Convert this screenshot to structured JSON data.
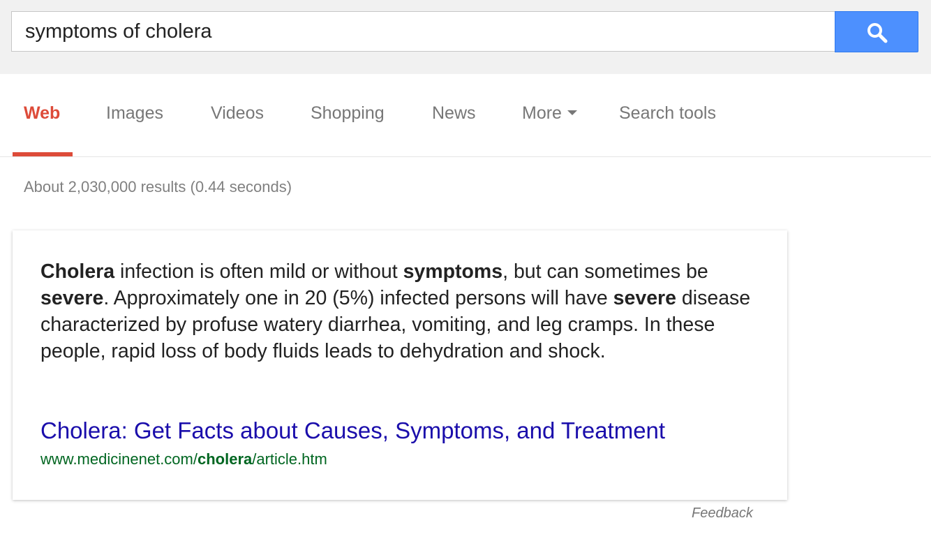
{
  "search": {
    "query": "symptoms of cholera",
    "button_icon": "search-icon"
  },
  "tabs": [
    {
      "label": "Web",
      "active": true
    },
    {
      "label": "Images",
      "active": false
    },
    {
      "label": "Videos",
      "active": false
    },
    {
      "label": "Shopping",
      "active": false
    },
    {
      "label": "News",
      "active": false
    },
    {
      "label": "More",
      "active": false,
      "icon": "caret-down-icon"
    },
    {
      "label": "Search tools",
      "active": false
    }
  ],
  "result_stats": "About 2,030,000 results (0.44 seconds)",
  "answer": {
    "segments": [
      {
        "text": "Cholera",
        "bold": true
      },
      {
        "text": " infection is often mild or without ",
        "bold": false
      },
      {
        "text": "symptoms",
        "bold": true
      },
      {
        "text": ", but can sometimes be ",
        "bold": false
      },
      {
        "text": "severe",
        "bold": true
      },
      {
        "text": ". Approximately one in 20 (5%) infected persons will have ",
        "bold": false
      },
      {
        "text": "severe",
        "bold": true
      },
      {
        "text": " disease characterized by profuse watery diarrhea, vomiting, and leg cramps. In these people, rapid loss of body fluids leads to dehydration and shock.",
        "bold": false
      }
    ],
    "source_title": "Cholera: Get Facts about Causes, Symptoms, and Treatment",
    "source_url": {
      "prefix": "www.medicinenet.com/",
      "bold": "cholera",
      "suffix": "/article.htm"
    }
  },
  "feedback_label": "Feedback",
  "colors": {
    "header_bg": "#f1f1f1",
    "search_button": "#4d90fe",
    "active_tab": "#dd4b39",
    "inactive_tab": "#777777",
    "link": "#1a0dab",
    "url": "#006621"
  }
}
